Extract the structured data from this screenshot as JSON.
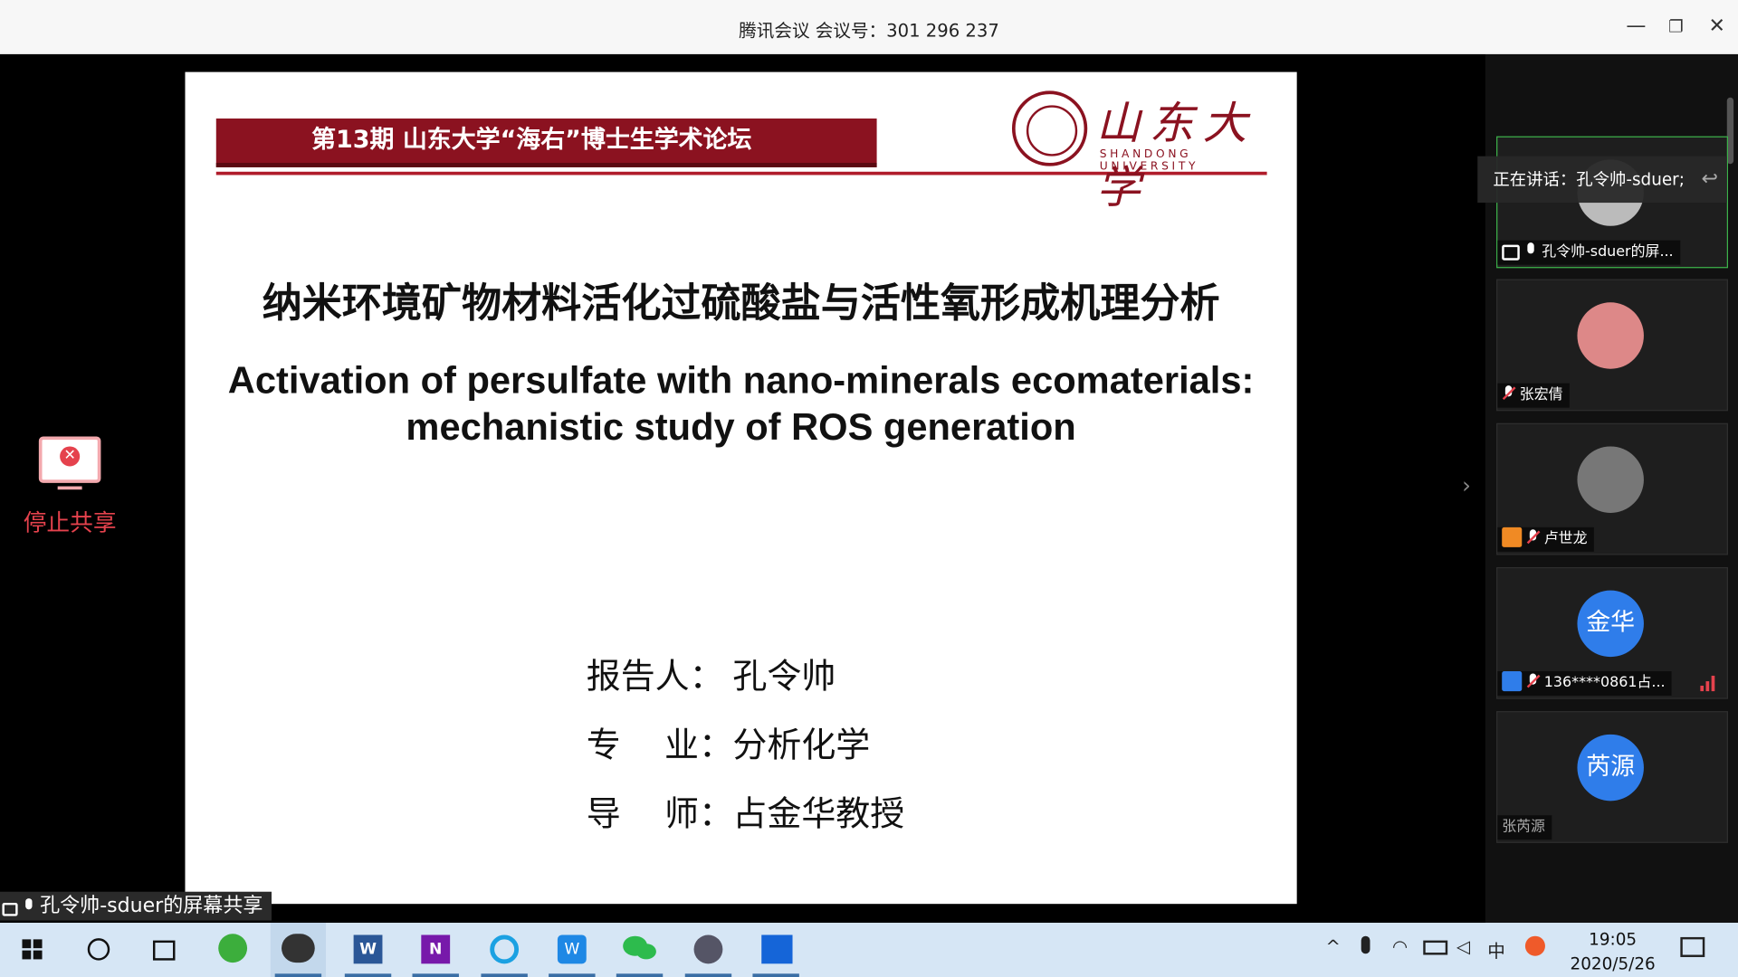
{
  "window": {
    "title": "腾讯会议 会议号：301 296 237",
    "minimize": "—",
    "maximize": "❐",
    "close": "✕"
  },
  "slide": {
    "banner": "第13期 山东大学“海右”博士生学术论坛",
    "logo_cn": "山东大学",
    "logo_en": "SHANDONG UNIVERSITY",
    "title_cn": "纳米环境矿物材料活化过硫酸盐与活性氧形成机理分析",
    "title_en_1": "Activation of persulfate with nano-minerals ecomaterials:",
    "title_en_2": "mechanistic study of ROS generation",
    "reporter_key": "报告人：",
    "reporter_val": "孔令帅",
    "major_key": "专    业：",
    "major_val": "分析化学",
    "advisor_key": "导    师：",
    "advisor_val": "占金华教授"
  },
  "stop_share": {
    "label": "停止共享"
  },
  "share_label": "孔令帅-sduer的屏幕共享",
  "speaking": {
    "text": "正在讲话：孔令帅-sduer;",
    "icon": "reply-arrow-icon"
  },
  "participants": [
    {
      "label": "孔令帅-sduer的屏...",
      "mic": "on",
      "sharing": true
    },
    {
      "label": "张宏倩",
      "mic": "off"
    },
    {
      "label": "卢世龙",
      "mic": "off"
    },
    {
      "label": "136****0861占...",
      "mic": "off",
      "avatar_text": "金华"
    },
    {
      "label": "张芮源",
      "avatar_text": "芮源"
    }
  ],
  "taskbar": {
    "time": "19:05",
    "date": "2020/5/26",
    "ime": "中"
  },
  "colors": {
    "accent_red": "#e5424d",
    "slide_banner": "#8b1220",
    "avatar_blue": "#2f7dea",
    "active_green": "#3db34a"
  }
}
